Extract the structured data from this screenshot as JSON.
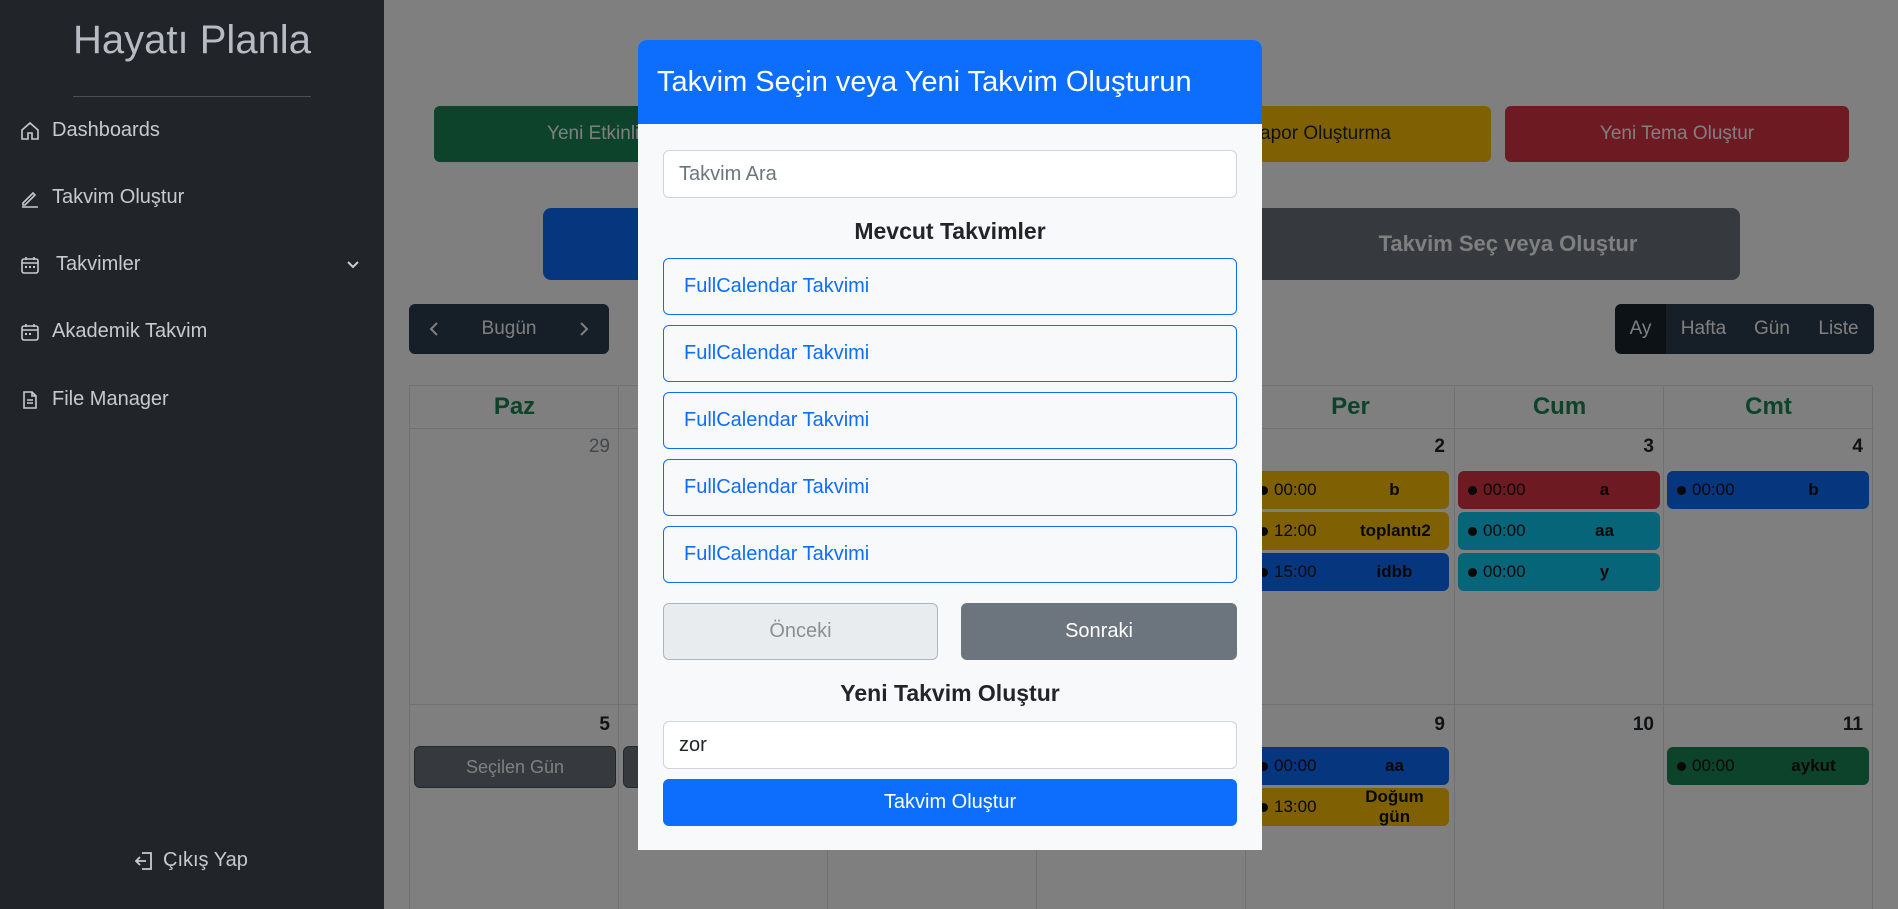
{
  "sidebar": {
    "brand": "Hayatı Planla",
    "items": [
      {
        "label": "Dashboards",
        "icon": "home-icon"
      },
      {
        "label": "Takvim Oluştur",
        "icon": "pencil-icon"
      },
      {
        "label": "Takvimler",
        "icon": "calendar-icon"
      },
      {
        "label": "Akademik Takvim",
        "icon": "calendar-icon"
      },
      {
        "label": "File Manager",
        "icon": "file-icon"
      }
    ],
    "logout": "Çıkış Yap"
  },
  "main": {
    "top_buttons": [
      {
        "label": "Yeni Etkinlik Pl",
        "color": "#198754"
      },
      {
        "label": "apor Oluşturma",
        "color": "#ffc107"
      },
      {
        "label": "Yeni Tema Oluştur",
        "color": "#dc3545"
      }
    ],
    "big_buttons": [
      {
        "label": "",
        "color": "#0d6efd"
      },
      {
        "label": "Takvim Seç veya Oluştur",
        "color": "#6c757d"
      }
    ],
    "toolbar": {
      "today": "Bugün"
    },
    "views": [
      "Ay",
      "Hafta",
      "Gün",
      "Liste"
    ],
    "days_of_week": [
      "Paz",
      "",
      "",
      "",
      "Per",
      "Cum",
      "Cmt"
    ],
    "week1_days": {
      "sun": "29",
      "thu": "2",
      "fri": "3",
      "sat": "4"
    },
    "week2_days": {
      "sun": "5",
      "thu": "9",
      "fri": "10",
      "sat": "11"
    },
    "selected_day_label": "Seçilen Gün",
    "events": {
      "thu1": [
        {
          "time": "00:00",
          "title": "b",
          "color": "#ffc107"
        },
        {
          "time": "12:00",
          "title": "toplantı2",
          "color": "#ffc107"
        },
        {
          "time": "15:00",
          "title": "idbb",
          "color": "#0d6efd"
        }
      ],
      "fri1": [
        {
          "time": "00:00",
          "title": "a",
          "color": "#dc3545"
        },
        {
          "time": "00:00",
          "title": "aa",
          "color": "#0dcaf0"
        },
        {
          "time": "00:00",
          "title": "y",
          "color": "#0dcaf0"
        }
      ],
      "sat1": [
        {
          "time": "00:00",
          "title": "b",
          "color": "#0d6efd"
        }
      ],
      "thu2": [
        {
          "time": "00:00",
          "title": "aa",
          "color": "#0d6efd"
        },
        {
          "time": "13:00",
          "title": "Doğum gün",
          "color": "#ffc107"
        }
      ],
      "sat2": [
        {
          "time": "00:00",
          "title": "aykut",
          "color": "#198754"
        }
      ]
    }
  },
  "modal": {
    "title": "Takvim Seçin veya Yeni Takvim Oluşturun",
    "search_placeholder": "Takvim Ara",
    "existing_title": "Mevcut Takvimler",
    "calendars": [
      "FullCalendar Takvimi",
      "FullCalendar Takvimi",
      "FullCalendar Takvimi",
      "FullCalendar Takvimi",
      "FullCalendar Takvimi"
    ],
    "prev_label": "Önceki",
    "next_label": "Sonraki",
    "new_title": "Yeni Takvim Oluştur",
    "new_value": "zor",
    "create_label": "Takvim Oluştur"
  }
}
